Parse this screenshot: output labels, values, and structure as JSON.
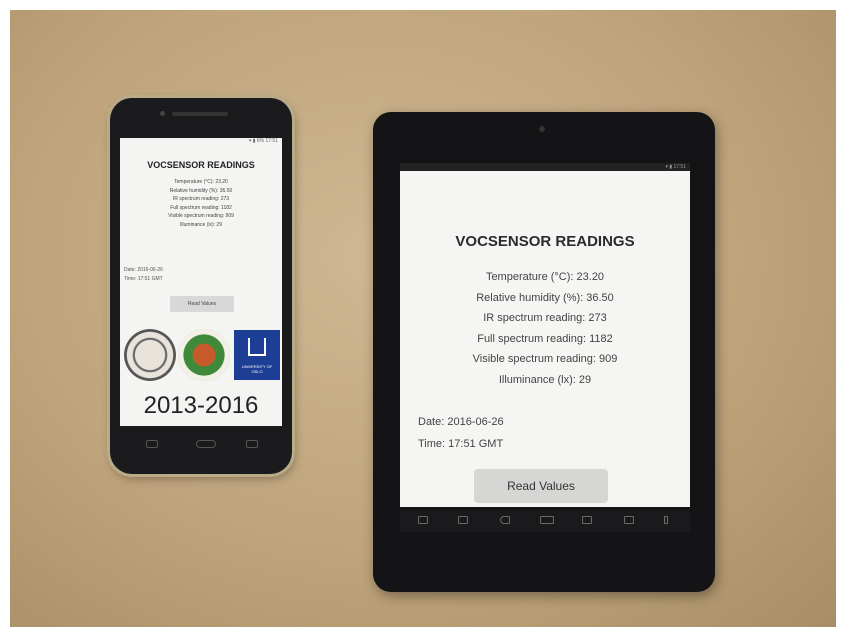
{
  "phone": {
    "status": "▾ ▮ 6% 17:51",
    "title": "VOCSENSOR READINGS",
    "readings": [
      "Temperature (°C): 23.20",
      "Relative humidity (%): 36.50",
      "IR spectrum reading: 273",
      "Full spectrum reading: 1182",
      "Visible spectrum reading: 909",
      "Illuminance (lx): 29"
    ],
    "date": "Date: 2016-06-26",
    "time": "Time: 17:51 GMT",
    "button_label": "Read Values",
    "logo_text": "UNIVERSITY OF OSLO",
    "years": "2013-2016"
  },
  "tablet": {
    "status": "▾ ▮ 17:51",
    "title": "VOCSENSOR READINGS",
    "readings": [
      "Temperature (°C): 23.20",
      "Relative humidity (%): 36.50",
      "IR spectrum reading: 273",
      "Full spectrum reading: 1182",
      "Visible spectrum reading: 909",
      "Illuminance (lx): 29"
    ],
    "date": "Date: 2016-06-26",
    "time": "Time: 17:51 GMT",
    "button_label": "Read Values",
    "nav_icons": [
      "screenshot-icon",
      "volume-down-icon",
      "back-icon",
      "home-icon",
      "recent-apps-icon",
      "volume-up-icon",
      "menu-icon"
    ]
  },
  "colors": {
    "table_wood": "#bfa47c",
    "device_black": "#1b1b1d",
    "screen_bg": "#f5f5f3",
    "uni_blue": "#1c3f95"
  }
}
